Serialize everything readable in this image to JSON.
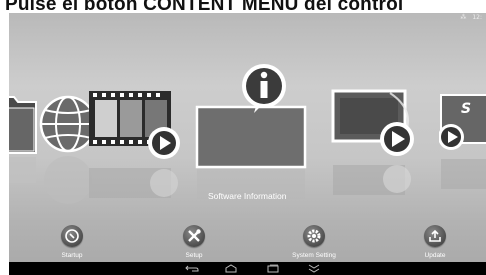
{
  "caption": "Pulse el botón CONTENT MENU del control",
  "status": {
    "signal_icon": "network-icon",
    "clock": "12:"
  },
  "carousel": {
    "selected_label": "Software Information",
    "items": [
      "folder-icon",
      "globe-icon",
      "film-icon",
      "software-information-icon",
      "slideshow-icon",
      "s-icon"
    ]
  },
  "menu": [
    {
      "label": "Startup",
      "icon": "startup-icon"
    },
    {
      "label": "Setup",
      "icon": "setup-icon"
    },
    {
      "label": "System Setting",
      "icon": "system-setting-icon"
    },
    {
      "label": "Update",
      "icon": "update-icon"
    }
  ],
  "navbar": [
    "back-icon",
    "home-icon",
    "recent-apps-icon",
    "hide-keyboard-icon"
  ],
  "colors": {
    "screen": "#c6c6c6",
    "navbar": "#000000",
    "label": "#ffffff"
  }
}
